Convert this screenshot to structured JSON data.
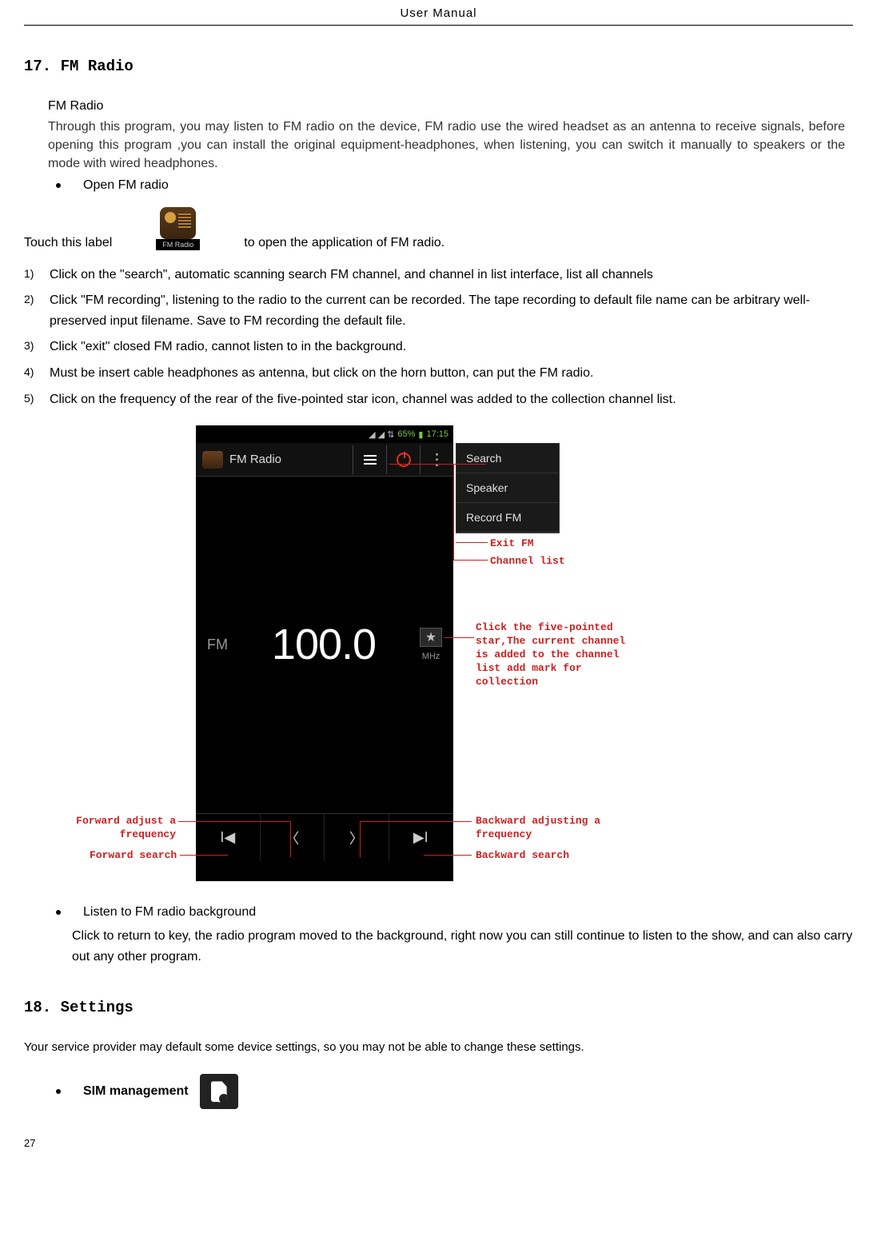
{
  "header": "User   Manual",
  "section17": {
    "title": "17. FM Radio",
    "subtitle": "FM Radio",
    "intro": "Through this program, you may listen to FM radio on the device, FM radio use the wired headset as an antenna to receive signals, before opening this program ,you can install  the original equipment-headphones, when listening, you can switch it manually  to speakers or the mode with wired headphones.",
    "bullet_open": "Open FM radio",
    "touch_before": "Touch this label",
    "touch_after": "to open the application of FM radio.",
    "app_icon_label": "FM Radio",
    "steps": [
      "Click on the \"search\", automatic scanning search FM channel, and channel in list interface, list all channels",
      "Click \"FM recording\", listening to the radio to the current can be recorded. The tape recording to default file name can be arbitrary well-preserved input filename. Save to FM recording the default file.",
      "Click \"exit\" closed FM radio, cannot listen to in the background.",
      "Must be insert cable headphones as antenna, but click on the horn button, can put the FM radio.",
      "Click on the frequency of the rear of the five-pointed star icon, channel was added to the collection channel list."
    ],
    "listen_bullet": "Listen to FM radio background",
    "listen_text": "Click to return to key, the radio program moved to the background, right now you can still continue to listen to the show, and can also carry out any other program."
  },
  "phone": {
    "status": {
      "battery_pct": "65%",
      "time": "17:15"
    },
    "titlebar": "FM Radio",
    "dropdown": [
      "Search",
      "Speaker",
      "Record FM"
    ],
    "fm_label": "FM",
    "frequency": "100.0",
    "mhz": "MHz"
  },
  "annotations": {
    "exit_fm": "Exit FM",
    "channel_list": "Channel list",
    "star_note": "Click the five-pointed star,The current channel is added to the channel list add mark for collection",
    "fwd_adjust": "Forward adjust a frequency",
    "fwd_search": "Forward search",
    "bwd_adjust": "Backward adjusting a frequency",
    "bwd_search": "Backward search"
  },
  "section18": {
    "title": "18. Settings",
    "intro": "Your service provider may default some device settings, so you may not be able to change these settings.",
    "sim_label": "SIM management"
  },
  "page_number": "27"
}
